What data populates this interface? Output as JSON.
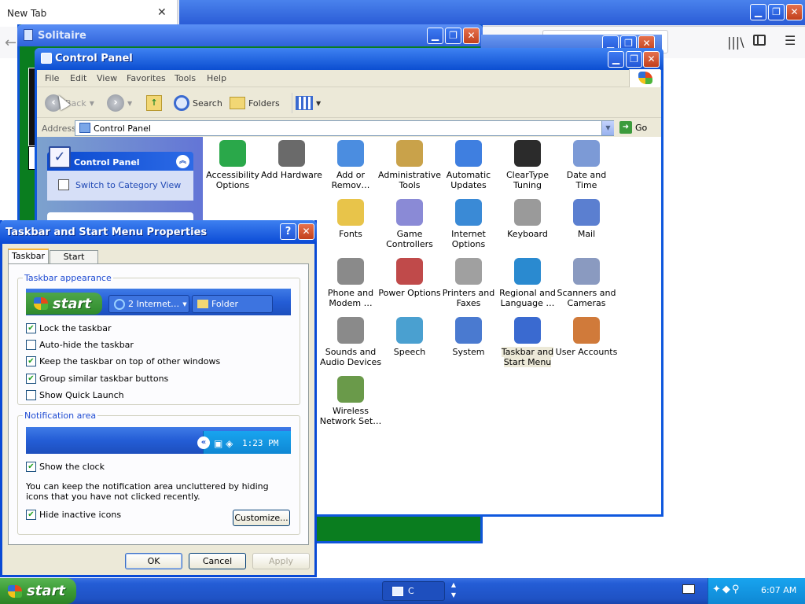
{
  "browser": {
    "tab_title": "New Tab",
    "tab_close": "✕",
    "new_tab": "+",
    "back": "←",
    "library": "|||\\",
    "menu": "☰"
  },
  "outer_window": {
    "min": "▁",
    "max": "❐",
    "close": "✕"
  },
  "solitaire": {
    "title": "Solitaire"
  },
  "control_panel": {
    "title": "Control Panel",
    "menu": [
      "File",
      "Edit",
      "View",
      "Favorites",
      "Tools",
      "Help"
    ],
    "toolbar": {
      "back": "Back",
      "search": "Search",
      "folders": "Folders"
    },
    "address_label": "Address",
    "address_value": "Control Panel",
    "go": "Go",
    "taskpane": {
      "title": "Control Panel",
      "link": "Switch to Category View"
    },
    "items": [
      {
        "label": "Accessibility Options",
        "color": "#2aa84a"
      },
      {
        "label": "Add Hardware",
        "color": "#6a6a6a"
      },
      {
        "label": "Add or Remov…",
        "color": "#4b8de0"
      },
      {
        "label": "Administrative Tools",
        "color": "#c9a24a"
      },
      {
        "label": "Automatic Updates",
        "color": "#3f7fe0"
      },
      {
        "label": "ClearType Tuning",
        "color": "#2b2b2b"
      },
      {
        "label": "Date and Time",
        "color": "#7c9ad6"
      },
      {
        "label": "",
        "color": "#7aa6e8"
      },
      {
        "label": "",
        "color": "#e0c24a"
      },
      {
        "label": "Fonts",
        "color": "#e8c44a"
      },
      {
        "label": "Game Controllers",
        "color": "#8a8ad6"
      },
      {
        "label": "Internet Options",
        "color": "#3a8ad6"
      },
      {
        "label": "Keyboard",
        "color": "#9a9a9a"
      },
      {
        "label": "Mail",
        "color": "#5b7fd0"
      },
      {
        "label": "",
        "color": "#ffffff"
      },
      {
        "label": "",
        "color": "#ffffff"
      },
      {
        "label": "Phone and Modem …",
        "color": "#8a8a8a"
      },
      {
        "label": "Power Options",
        "color": "#c04a4a"
      },
      {
        "label": "Printers and Faxes",
        "color": "#a0a0a0"
      },
      {
        "label": "Regional and Language …",
        "color": "#2a8ad0"
      },
      {
        "label": "Scanners and Cameras",
        "color": "#8a9ac0"
      },
      {
        "label": "",
        "color": "#ffffff"
      },
      {
        "label": "",
        "color": "#ffffff"
      },
      {
        "label": "Sounds and Audio Devices",
        "color": "#8a8a8a"
      },
      {
        "label": "Speech",
        "color": "#4aa0d0"
      },
      {
        "label": "System",
        "color": "#4a7ad0"
      },
      {
        "label": "Taskbar and Start Menu",
        "color": "#3a6ad0"
      },
      {
        "label": "User Accounts",
        "color": "#d07a3a"
      },
      {
        "label": "",
        "color": "#ffffff"
      },
      {
        "label": "",
        "color": "#ffffff"
      },
      {
        "label": "Wireless Network Set…",
        "color": "#6a9a4a"
      }
    ]
  },
  "dialog": {
    "title": "Taskbar and Start Menu Properties",
    "help": "?",
    "close": "✕",
    "tabs": [
      "Taskbar",
      "Start Menu"
    ],
    "appearance_label": "Taskbar appearance",
    "preview": {
      "start": "start",
      "ie": "2 Internet…",
      "folder": "Folder"
    },
    "options": [
      {
        "label": "Lock the taskbar",
        "checked": "✔"
      },
      {
        "label": "Auto-hide the taskbar",
        "checked": ""
      },
      {
        "label": "Keep the taskbar on top of other windows",
        "checked": "✔"
      },
      {
        "label": "Group similar taskbar buttons",
        "checked": "✔"
      },
      {
        "label": "Show Quick Launch",
        "checked": ""
      }
    ],
    "notification_label": "Notification area",
    "tray_clock": "1:23 PM",
    "show_clock": {
      "label": "Show the clock",
      "checked": "✔"
    },
    "description": "You can keep the notification area uncluttered by hiding icons that you have not clicked recently.",
    "hide_inactive": {
      "label": "Hide inactive icons",
      "checked": "✔"
    },
    "customize": "Customize...",
    "ok": "OK",
    "cancel": "Cancel",
    "apply": "Apply"
  },
  "taskbar": {
    "start": "start",
    "task_item": "C",
    "clock": "6:07 AM"
  }
}
